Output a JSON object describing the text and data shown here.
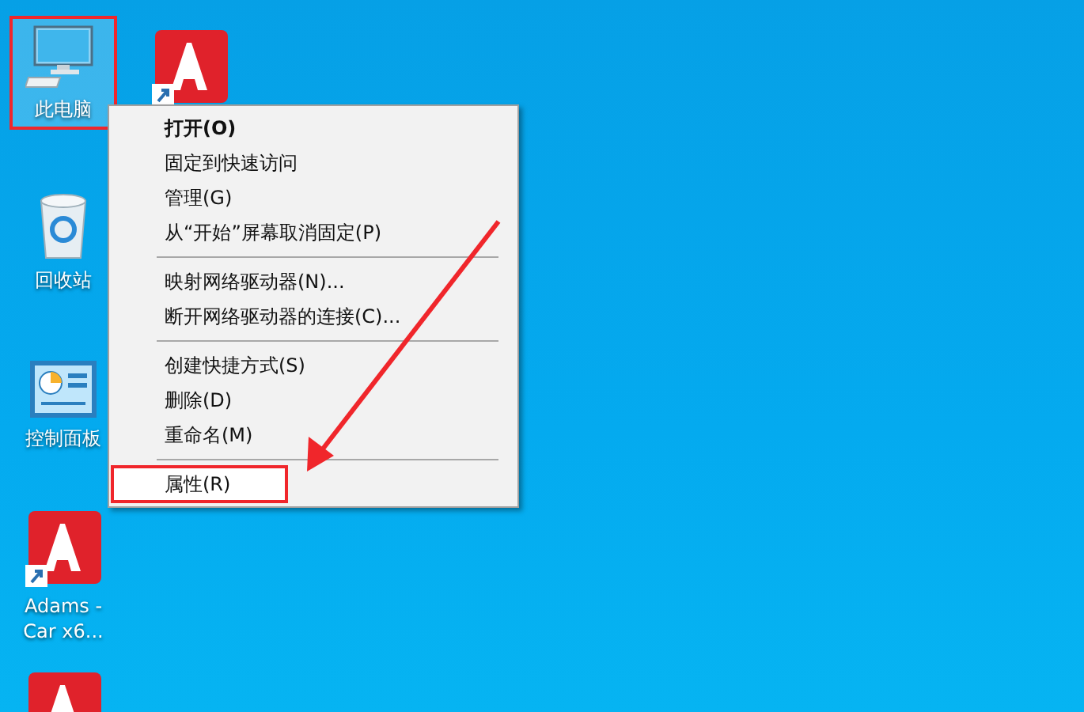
{
  "desktop_icons": [
    {
      "kind": "computer",
      "label": "此电脑",
      "selected": true,
      "highlighted": true
    },
    {
      "kind": "recycle-bin",
      "label": "回收站",
      "selected": false,
      "highlighted": false
    },
    {
      "kind": "control-panel",
      "label": "控制面板",
      "selected": false,
      "highlighted": false
    },
    {
      "kind": "app-shortcut",
      "label": "Adams - Car x6...",
      "selected": false,
      "highlighted": false
    },
    {
      "kind": "app-shortcut",
      "selected": false,
      "highlighted": false
    },
    {
      "kind": "app-shortcut",
      "selected": false,
      "highlighted": false
    }
  ],
  "context_menu": {
    "items": [
      {
        "kind": "item",
        "label": "打开(O)",
        "bold": true,
        "selected": false,
        "highlighted": false
      },
      {
        "kind": "item",
        "label": "固定到快速访问",
        "bold": false,
        "selected": false,
        "highlighted": false
      },
      {
        "kind": "item",
        "label": "管理(G)",
        "bold": false,
        "selected": false,
        "highlighted": false
      },
      {
        "kind": "item",
        "label": "从“开始”屏幕取消固定(P)",
        "bold": false,
        "selected": false,
        "highlighted": false
      },
      {
        "kind": "separator"
      },
      {
        "kind": "item",
        "label": "映射网络驱动器(N)...",
        "bold": false,
        "selected": false,
        "highlighted": false
      },
      {
        "kind": "item",
        "label": "断开网络驱动器的连接(C)...",
        "bold": false,
        "selected": false,
        "highlighted": false
      },
      {
        "kind": "separator"
      },
      {
        "kind": "item",
        "label": "创建快捷方式(S)",
        "bold": false,
        "selected": false,
        "highlighted": false
      },
      {
        "kind": "item",
        "label": "删除(D)",
        "bold": false,
        "selected": false,
        "highlighted": false
      },
      {
        "kind": "item",
        "label": "重命名(M)",
        "bold": false,
        "selected": false,
        "highlighted": false
      },
      {
        "kind": "separator"
      },
      {
        "kind": "item",
        "label": "属性(R)",
        "bold": false,
        "selected": true,
        "highlighted": true
      }
    ]
  }
}
